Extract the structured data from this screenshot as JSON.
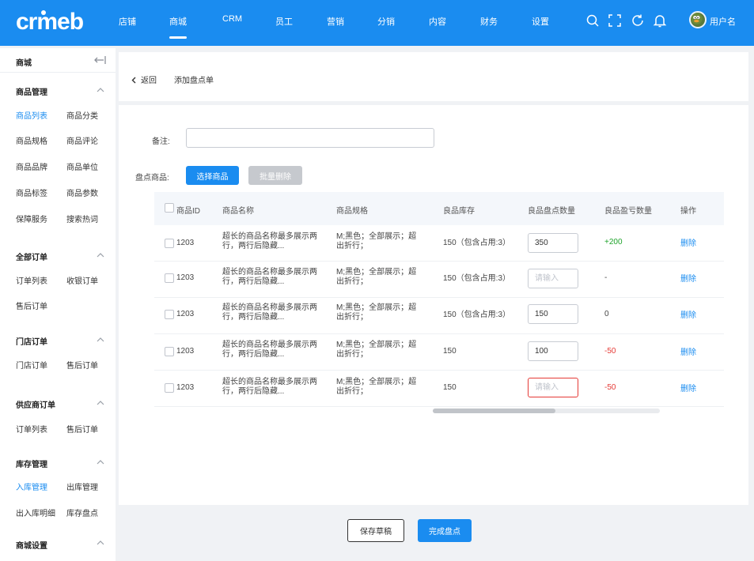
{
  "brand": {
    "name": "crmeb"
  },
  "header": {
    "nav": [
      {
        "label": "店铺"
      },
      {
        "label": "商城"
      },
      {
        "label": "CRM"
      },
      {
        "label": "员工"
      },
      {
        "label": "营销"
      },
      {
        "label": "分销"
      },
      {
        "label": "内容"
      },
      {
        "label": "财务"
      },
      {
        "label": "设置"
      }
    ],
    "active_nav": "商城",
    "icons": [
      "search-icon",
      "fullscreen-icon",
      "refresh-icon",
      "bell-icon"
    ],
    "user_name": "用户名"
  },
  "sidebar": {
    "title": "商城",
    "groups": [
      {
        "title": "商品管理",
        "items": [
          "商品列表",
          "商品分类",
          "商品规格",
          "商品评论",
          "商品品牌",
          "商品单位",
          "商品标签",
          "商品参数",
          "保障服务",
          "搜索热词"
        ]
      },
      {
        "title": "全部订单",
        "items": [
          "订单列表",
          "收银订单",
          "售后订单"
        ]
      },
      {
        "title": "门店订单",
        "items": [
          "门店订单",
          "售后订单"
        ]
      },
      {
        "title": "供应商订单",
        "items": [
          "订单列表",
          "售后订单"
        ]
      },
      {
        "title": "库存管理",
        "items": [
          "入库管理",
          "出库管理",
          "出入库明细",
          "库存盘点"
        ]
      },
      {
        "title": "商城设置",
        "items": []
      }
    ],
    "active_items": [
      "商品列表",
      "入库管理"
    ]
  },
  "page": {
    "back_label": "返回",
    "title": "添加盘点单"
  },
  "form": {
    "remark_label": "备注:",
    "remark_value": "",
    "products_label": "盘点商品:",
    "select_button": "选择商品",
    "batch_delete_button": "批量删除"
  },
  "table": {
    "columns": [
      "商品ID",
      "商品名称",
      "商品规格",
      "良品库存",
      "良品盘点数量",
      "良品盈亏数量",
      "操作"
    ],
    "rows": [
      {
        "id": "1203",
        "name": "超长的商品名称最多展示两行，两行后隐藏...",
        "spec": "M;黑色；全部展示；超出折行；",
        "stock": "150（包含占用:3）",
        "count_value": "350",
        "count_placeholder": "请输入",
        "diff": "+200",
        "action": "删除"
      },
      {
        "id": "1203",
        "name": "超长的商品名称最多展示两行，两行后隐藏...",
        "spec": "M;黑色；全部展示；超出折行；",
        "stock": "150（包含占用:3）",
        "count_value": "",
        "count_placeholder": "请输入",
        "diff": "-",
        "action": "删除"
      },
      {
        "id": "1203",
        "name": "超长的商品名称最多展示两行，两行后隐藏...",
        "spec": "M;黑色；全部展示；超出折行；",
        "stock": "150（包含占用:3）",
        "count_value": "150",
        "count_placeholder": "请输入",
        "diff": "0",
        "action": "删除"
      },
      {
        "id": "1203",
        "name": "超长的商品名称最多展示两行，两行后隐藏...",
        "spec": "M;黑色；全部展示；超出折行；",
        "stock": "150",
        "count_value": "100",
        "count_placeholder": "请输入",
        "diff": "-50",
        "action": "删除"
      },
      {
        "id": "1203",
        "name": "超长的商品名称最多展示两行，两行后隐藏...",
        "spec": "M;黑色；全部展示；超出折行；",
        "stock": "150",
        "count_value": "",
        "count_placeholder": "请输入",
        "diff": "-50",
        "action": "删除",
        "error": true
      }
    ],
    "scroll_progress": 0.54
  },
  "footer": {
    "save_draft": "保存草稿",
    "complete": "完成盘点"
  },
  "colors": {
    "primary": "#1a8cf0",
    "positive": "#1fa32b",
    "negative": "#e53935",
    "disabled": "#c6c9ce"
  }
}
